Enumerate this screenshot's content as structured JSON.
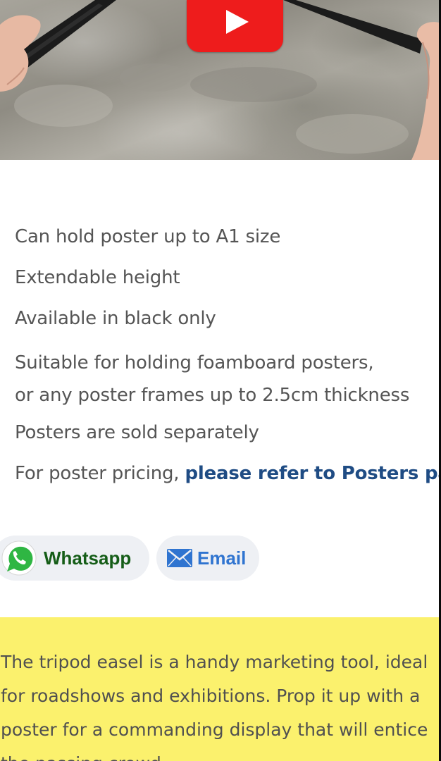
{
  "video": {
    "play_icon": "youtube-play-icon",
    "colors": {
      "play_button": "#ee1c1c"
    }
  },
  "features": [
    {
      "lines": [
        "Can hold poster up to A1 size"
      ]
    },
    {
      "lines": [
        "Extendable height"
      ]
    },
    {
      "lines": [
        "Available in black only"
      ]
    },
    {
      "lines": [
        "Suitable for holding foamboard posters,",
        "or any poster frames up to 2.5cm thickness"
      ]
    },
    {
      "lines": [
        "Posters are sold separately"
      ]
    },
    {
      "text": "For poster pricing, ",
      "link": "please refer to Posters page"
    }
  ],
  "share": {
    "whatsapp_label": "Whatsapp",
    "whatsapp_icon": "whatsapp-icon",
    "email_label": "Email",
    "email_icon": "envelope-icon",
    "colors": {
      "whatsapp": "#155d17",
      "email": "#2f74d0"
    }
  },
  "description": {
    "lines": [
      "The tripod easel is a handy marketing tool, ideal",
      "for roadshows and exhibitions. Prop it up with a",
      "poster for a commanding display that will entice",
      "the passing crowd."
    ],
    "colors": {
      "background": "#fbf16d"
    }
  }
}
